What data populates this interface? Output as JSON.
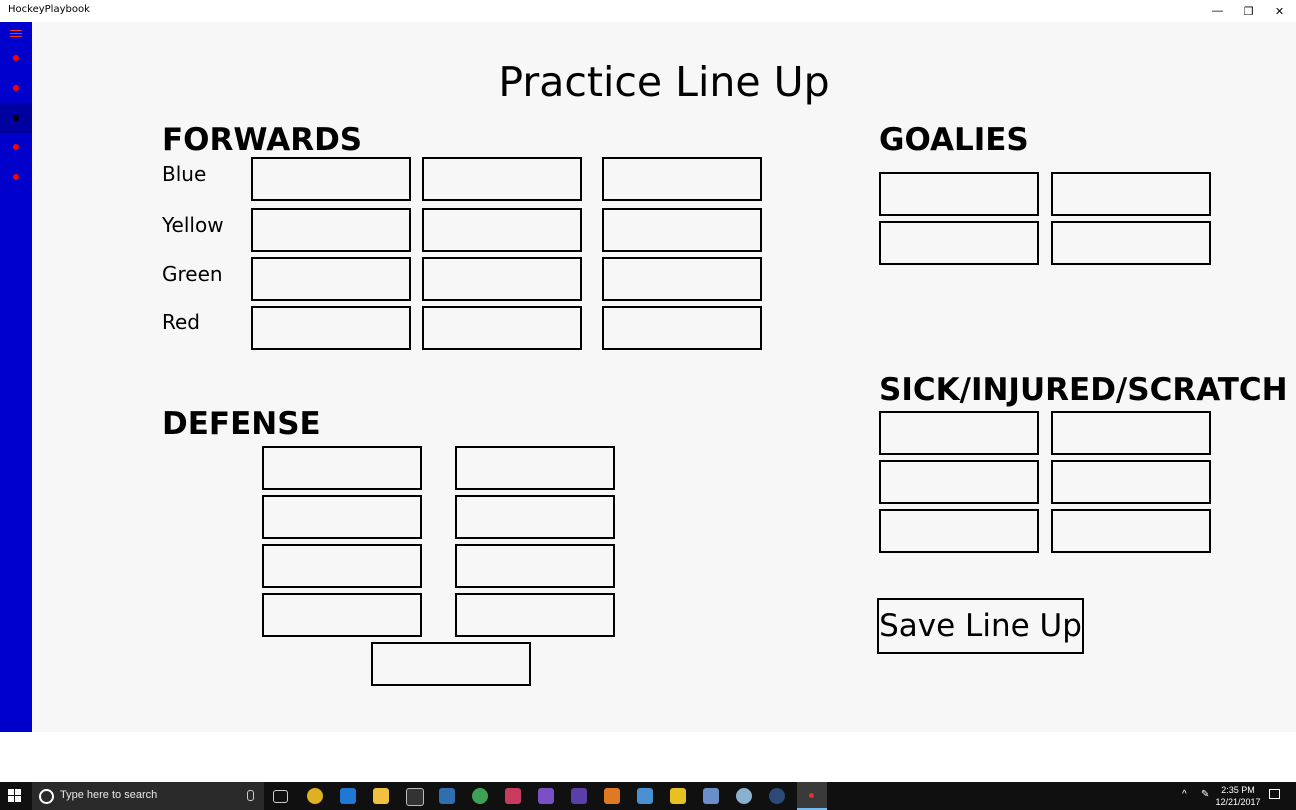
{
  "window": {
    "title": "HockeyPlaybook",
    "minimize": "—",
    "maximize": "❐",
    "close": "✕"
  },
  "sidebar": {
    "items": [
      "nav-1",
      "nav-2",
      "nav-3",
      "nav-4",
      "nav-5"
    ],
    "active_index": 2
  },
  "page": {
    "title": "Practice Line Up"
  },
  "forwards": {
    "heading": "FORWARDS",
    "lines": [
      {
        "label": "Blue"
      },
      {
        "label": "Yellow"
      },
      {
        "label": "Green"
      },
      {
        "label": "Red"
      }
    ]
  },
  "defense": {
    "heading": "DEFENSE"
  },
  "goalies": {
    "heading": "GOALIES"
  },
  "sick": {
    "heading": "SICK/INJURED/SCRATCH"
  },
  "save_button": {
    "label": "Save Line Up"
  },
  "taskbar": {
    "search_placeholder": "Type here to search",
    "time": "2:35 PM",
    "date": "12/21/2017"
  },
  "colors": {
    "sidebar": "#0000cc",
    "nav_dot": "#ff0000",
    "content_bg": "#f7f7f7"
  }
}
